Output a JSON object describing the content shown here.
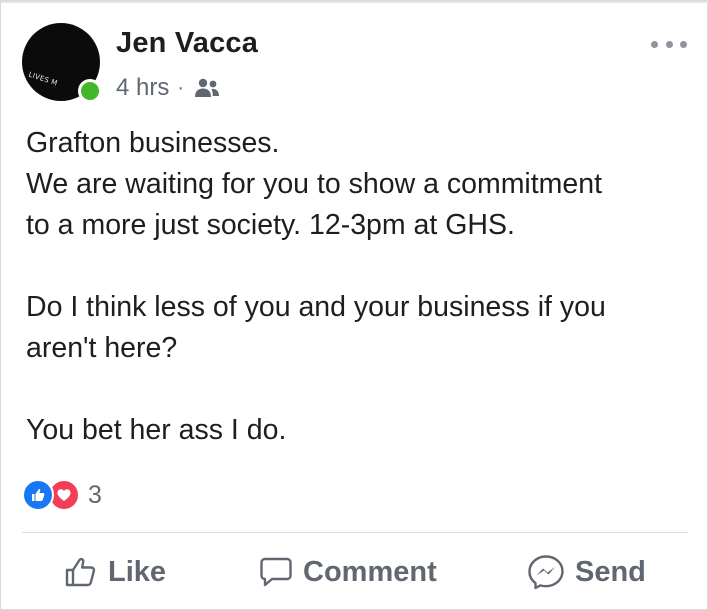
{
  "post": {
    "author": "Jen Vacca",
    "time": "4 hrs",
    "separator": "·",
    "audience_icon": "friends-icon",
    "avatar_text": "LIVES M",
    "body": {
      "line1": "Grafton businesses.",
      "line2": "We are waiting for you to show a commitment",
      "line3": "to a more just society. 12-3pm at GHS.",
      "line4": "Do I think less of you and your business if you",
      "line5": "aren't here?",
      "line6": "You bet her ass I do."
    },
    "reactions": {
      "types": [
        "like",
        "love"
      ],
      "count": "3"
    },
    "actions": {
      "like": "Like",
      "comment": "Comment",
      "send": "Send"
    }
  },
  "colors": {
    "like_blue": "#1877f2",
    "love_red": "#f33e58",
    "online_green": "#42b72a",
    "secondary_text": "#606770"
  }
}
